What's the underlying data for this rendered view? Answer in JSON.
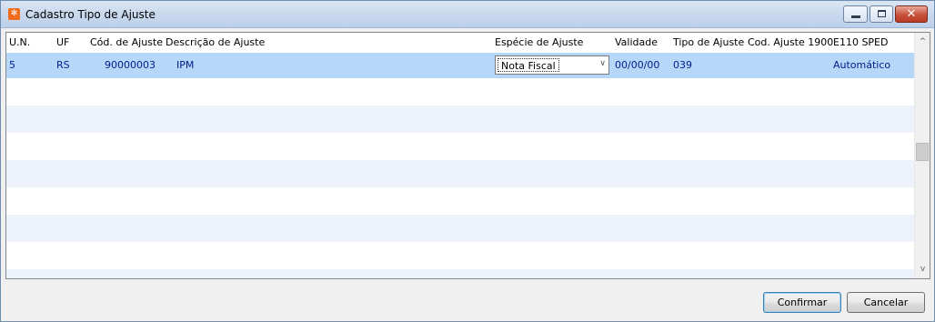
{
  "window": {
    "title": "Cadastro Tipo de Ajuste",
    "close_glyph": "✕"
  },
  "grid": {
    "columns": [
      "U.N.",
      "UF",
      "Cód. de Ajuste",
      "Descrição de Ajuste",
      "Espécie de Ajuste",
      "Validade",
      "Tipo de Ajuste",
      "Cod. Ajuste 1900",
      "E110 SPED"
    ],
    "rows": [
      {
        "un": "5",
        "uf": "RS",
        "cod_ajuste": "90000003",
        "descricao": "IPM",
        "especie": "Nota Fiscal",
        "validade": "00/00/00",
        "tipo": "039",
        "cod_1900": "",
        "e110": "Automático"
      }
    ]
  },
  "scrollbar": {
    "up": "^",
    "down": "v"
  },
  "buttons": {
    "confirm": "Confirmar",
    "cancel": "Cancelar"
  },
  "colors": {
    "selected_row": "#b6d7f7",
    "alt_row": "#eef3fb",
    "cell_text": "#001d8e"
  }
}
